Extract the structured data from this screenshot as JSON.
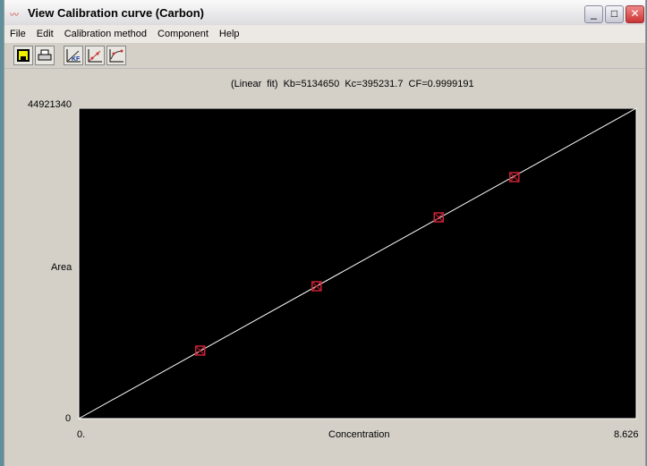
{
  "window": {
    "title": "View Calibration curve (Carbon)",
    "minimize": "_",
    "maximize": "□",
    "close": "✕"
  },
  "menu": [
    "File",
    "Edit",
    "Calibration method",
    "Component",
    "Help"
  ],
  "toolbar": [
    {
      "icon": "save-icon"
    },
    {
      "icon": "print-icon"
    },
    {
      "icon": "kf-curve-icon"
    },
    {
      "icon": "linear-fit-icon"
    },
    {
      "icon": "point-curve-icon"
    }
  ],
  "fit_info": "(Linear fit)   Kb=5134650   Kc=395231.7   CF=0.9999191",
  "chart_data": {
    "type": "scatter",
    "xlabel": "Concentration",
    "ylabel": "Area",
    "xlim": [
      0,
      8.626
    ],
    "ylim": [
      0,
      44921340
    ],
    "x_tick_labels": [
      "0.",
      "8.626"
    ],
    "y_tick_labels": [
      "0",
      "44921340"
    ],
    "fit": {
      "type": "linear",
      "slope": 5134650,
      "intercept": 395231.7,
      "cf": 0.9999191
    },
    "points": [
      {
        "x": 1.88,
        "y": 9840000
      },
      {
        "x": 3.68,
        "y": 19160000
      },
      {
        "x": 5.57,
        "y": 29130000
      },
      {
        "x": 6.74,
        "y": 34950000
      }
    ],
    "background": "#000000",
    "line_color": "#ffffff",
    "marker_color": "#cc2233",
    "grid": false
  }
}
